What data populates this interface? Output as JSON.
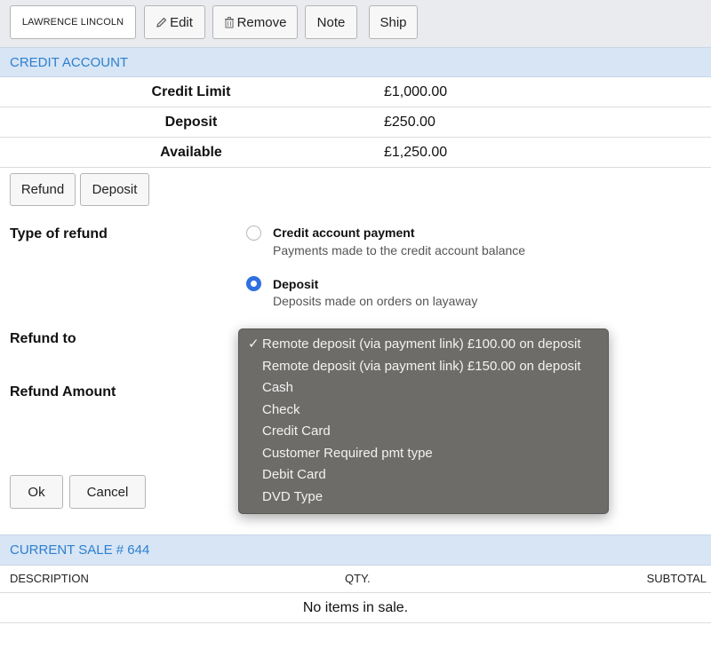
{
  "toolbar": {
    "customer_name": "LAWRENCE LINCOLN",
    "edit_label": "Edit",
    "remove_label": "Remove",
    "note_label": "Note",
    "ship_label": "Ship"
  },
  "credit_account": {
    "title": "CREDIT ACCOUNT",
    "rows": [
      {
        "label": "Credit Limit",
        "value": "£1,000.00"
      },
      {
        "label": "Deposit",
        "value": "£250.00"
      },
      {
        "label": "Available",
        "value": "£1,250.00"
      }
    ],
    "refund_button": "Refund",
    "deposit_button": "Deposit"
  },
  "refund_form": {
    "type_label": "Type of refund",
    "options": [
      {
        "title": "Credit account payment",
        "description": "Payments made to the credit account balance",
        "selected": false
      },
      {
        "title": "Deposit",
        "description": "Deposits made on orders on layaway",
        "selected": true
      }
    ],
    "refund_to_label": "Refund to",
    "refund_amount_label": "Refund Amount",
    "ok_label": "Ok",
    "cancel_label": "Cancel",
    "dropdown": {
      "check_mark": "✓",
      "items": [
        "Remote deposit (via payment link) £100.00 on deposit",
        "Remote deposit (via payment link) £150.00 on deposit",
        "Cash",
        "Check",
        "Credit Card",
        "Customer Required pmt type",
        "Debit Card",
        "DVD Type"
      ],
      "selected_index": 0
    }
  },
  "current_sale": {
    "title": "CURRENT SALE # 644",
    "columns": [
      "DESCRIPTION",
      "QTY.",
      "SUBTOTAL"
    ],
    "empty_message": "No items in sale."
  },
  "colors": {
    "accent": "#2d7fcf",
    "header_bg": "#d7e5f5",
    "radio_selected": "#2f6fe0",
    "dropdown_bg": "#6e6c69"
  }
}
